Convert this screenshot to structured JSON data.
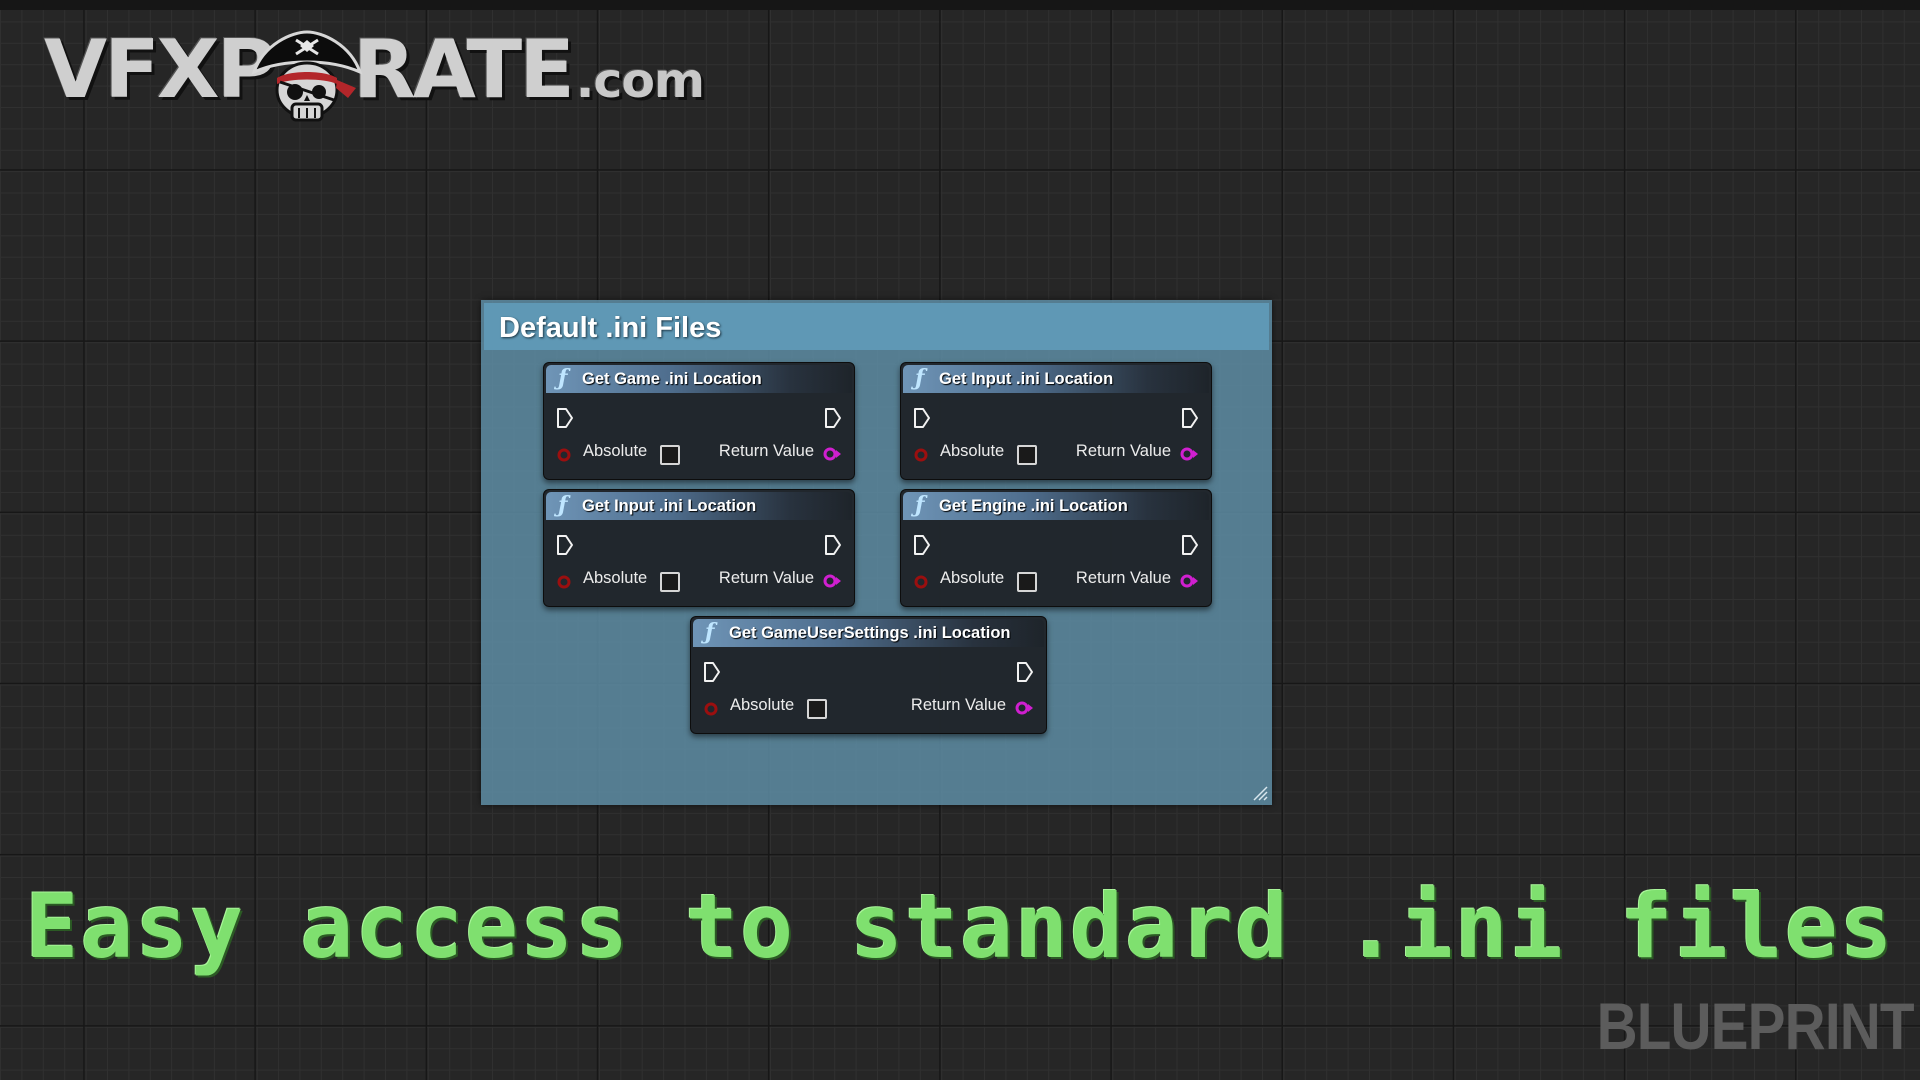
{
  "logo": {
    "main_text_1": "VFXP",
    "main_text_2": "RATE",
    "suffix": ".com"
  },
  "comment": {
    "title": "Default .ini Files"
  },
  "nodes": [
    {
      "title": "Get Game .ini Location",
      "param_label": "Absolute",
      "return_label": "Return Value"
    },
    {
      "title": "Get Input .ini Location",
      "param_label": "Absolute",
      "return_label": "Return Value"
    },
    {
      "title": "Get Input .ini Location",
      "param_label": "Absolute",
      "return_label": "Return Value"
    },
    {
      "title": "Get Engine .ini Location",
      "param_label": "Absolute",
      "return_label": "Return Value"
    },
    {
      "title": "Get GameUserSettings .ini Location",
      "param_label": "Absolute",
      "return_label": "Return Value"
    }
  ],
  "caption": "Easy access to standard .ini files",
  "watermark": "BLUEPRINT",
  "colors": {
    "comment_bg": "#5c8aa0",
    "comment_header": "#5f98b5",
    "node_header_accent": "#6f95b7",
    "bool_pin": "#9b0f0f",
    "string_pin": "#d01fd0",
    "caption": "#7fe06f",
    "watermark": "#5c5c5c"
  },
  "icons": {
    "function": "function-icon",
    "exec_in": "exec-in-pin-icon",
    "exec_out": "exec-out-pin-icon",
    "bool": "bool-pin-icon",
    "string": "string-pin-icon",
    "skull": "pirate-skull-icon",
    "resize": "resize-grip-icon"
  }
}
